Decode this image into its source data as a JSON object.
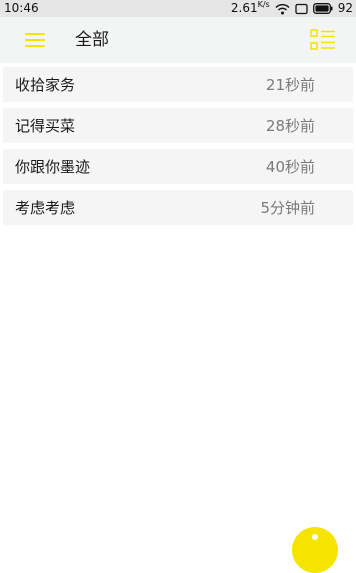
{
  "status_bar": {
    "time": "10:46",
    "net_speed": "2.61",
    "net_unit": "K/s",
    "battery_level": "92"
  },
  "toolbar": {
    "title": "全部",
    "menu_icon": "hamburger-menu-icon",
    "view_icon": "list-view-icon"
  },
  "items": [
    {
      "title": "收拾家务",
      "time": "21秒前"
    },
    {
      "title": "记得买菜",
      "time": "28秒前"
    },
    {
      "title": "你跟你墨迹",
      "time": "40秒前"
    },
    {
      "title": "考虑考虑",
      "time": "5分钟前"
    }
  ],
  "fab": {
    "icon": "add-icon"
  },
  "colors": {
    "accent": "#f5e400",
    "status_bar_bg": "#e6e6e6",
    "toolbar_bg": "#f3f5f4",
    "item_bg": "#f5f5f5"
  }
}
